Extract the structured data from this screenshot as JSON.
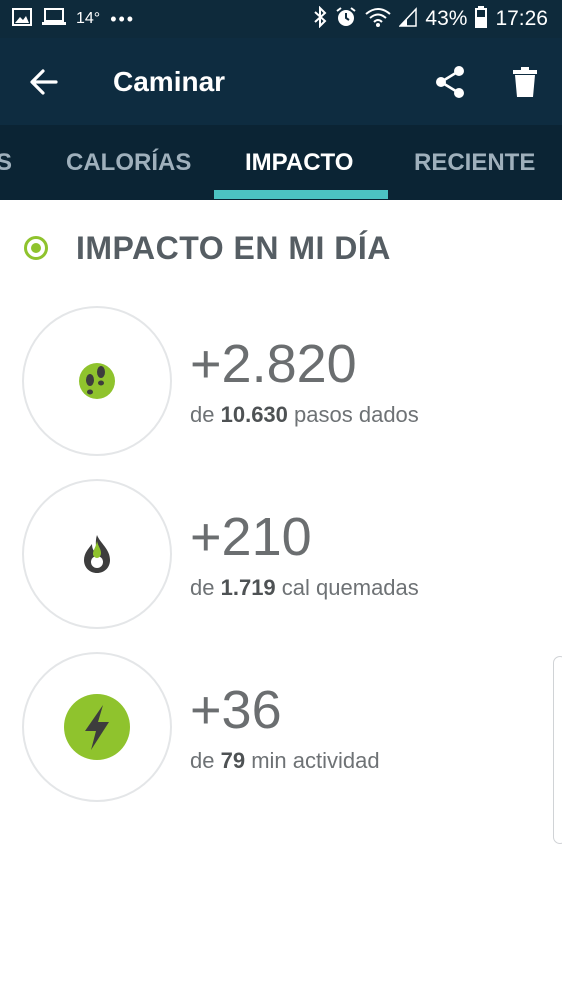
{
  "status_bar": {
    "temperature": "14°",
    "battery": "43%",
    "time": "17:26"
  },
  "toolbar": {
    "title": "Caminar"
  },
  "tabs": [
    {
      "label": "S",
      "active": false
    },
    {
      "label": "CALORÍAS",
      "active": false
    },
    {
      "label": "IMPACTO",
      "active": true
    },
    {
      "label": "RECIENTE",
      "active": false
    }
  ],
  "section": {
    "title": "IMPACTO EN MI DÍA"
  },
  "impacts": [
    {
      "icon": "footsteps-icon",
      "value": "+2.820",
      "prefix": "de",
      "total": "10.630",
      "suffix": "pasos dados"
    },
    {
      "icon": "flame-icon",
      "value": "+210",
      "prefix": "de",
      "total": "1.719",
      "suffix": "cal quemadas"
    },
    {
      "icon": "lightning-bolt-icon",
      "value": "+36",
      "prefix": "de",
      "total": "79",
      "suffix": "min actividad"
    }
  ],
  "colors": {
    "accent_green": "#8fc32d",
    "tab_indicator": "#4cc3c3",
    "header_bg": "#0e2c40"
  }
}
